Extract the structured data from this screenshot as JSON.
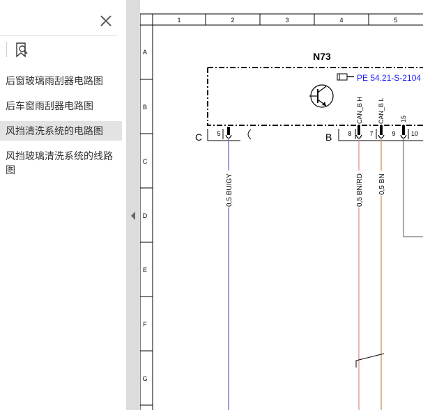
{
  "sidebar": {
    "items": [
      {
        "label": "后窗玻璃雨刮器电路图"
      },
      {
        "label": "后车窗雨刮器电路图"
      },
      {
        "label": "风挡清洗系统的电路图"
      },
      {
        "label": "风挡玻璃清洗系统的线路图"
      }
    ],
    "active_index": 2
  },
  "diagram": {
    "columns": [
      "1",
      "2",
      "3",
      "4",
      "5"
    ],
    "rows": [
      "A",
      "B",
      "C",
      "D",
      "E",
      "F",
      "G"
    ],
    "component": "N73",
    "reference": "PE 54.21-S-2104",
    "connector_c": "C",
    "connector_b": "B",
    "pins": {
      "c5": "5",
      "b8": "8",
      "b7": "7",
      "b9": "9",
      "b10": "10"
    },
    "signals": {
      "can_h": "CAN_B H",
      "can_l": "CAN_B L",
      "pin15": "15"
    },
    "wires": {
      "w1": "0,5 BU/GY",
      "w2": "0,5 BN/RD",
      "w3": "0,5 BN"
    },
    "colors": {
      "blue_wire": "#5a5ad6",
      "red_wire": "#d98a8a",
      "brown_wire": "#c88a50",
      "link_blue": "#1a1aff"
    }
  }
}
